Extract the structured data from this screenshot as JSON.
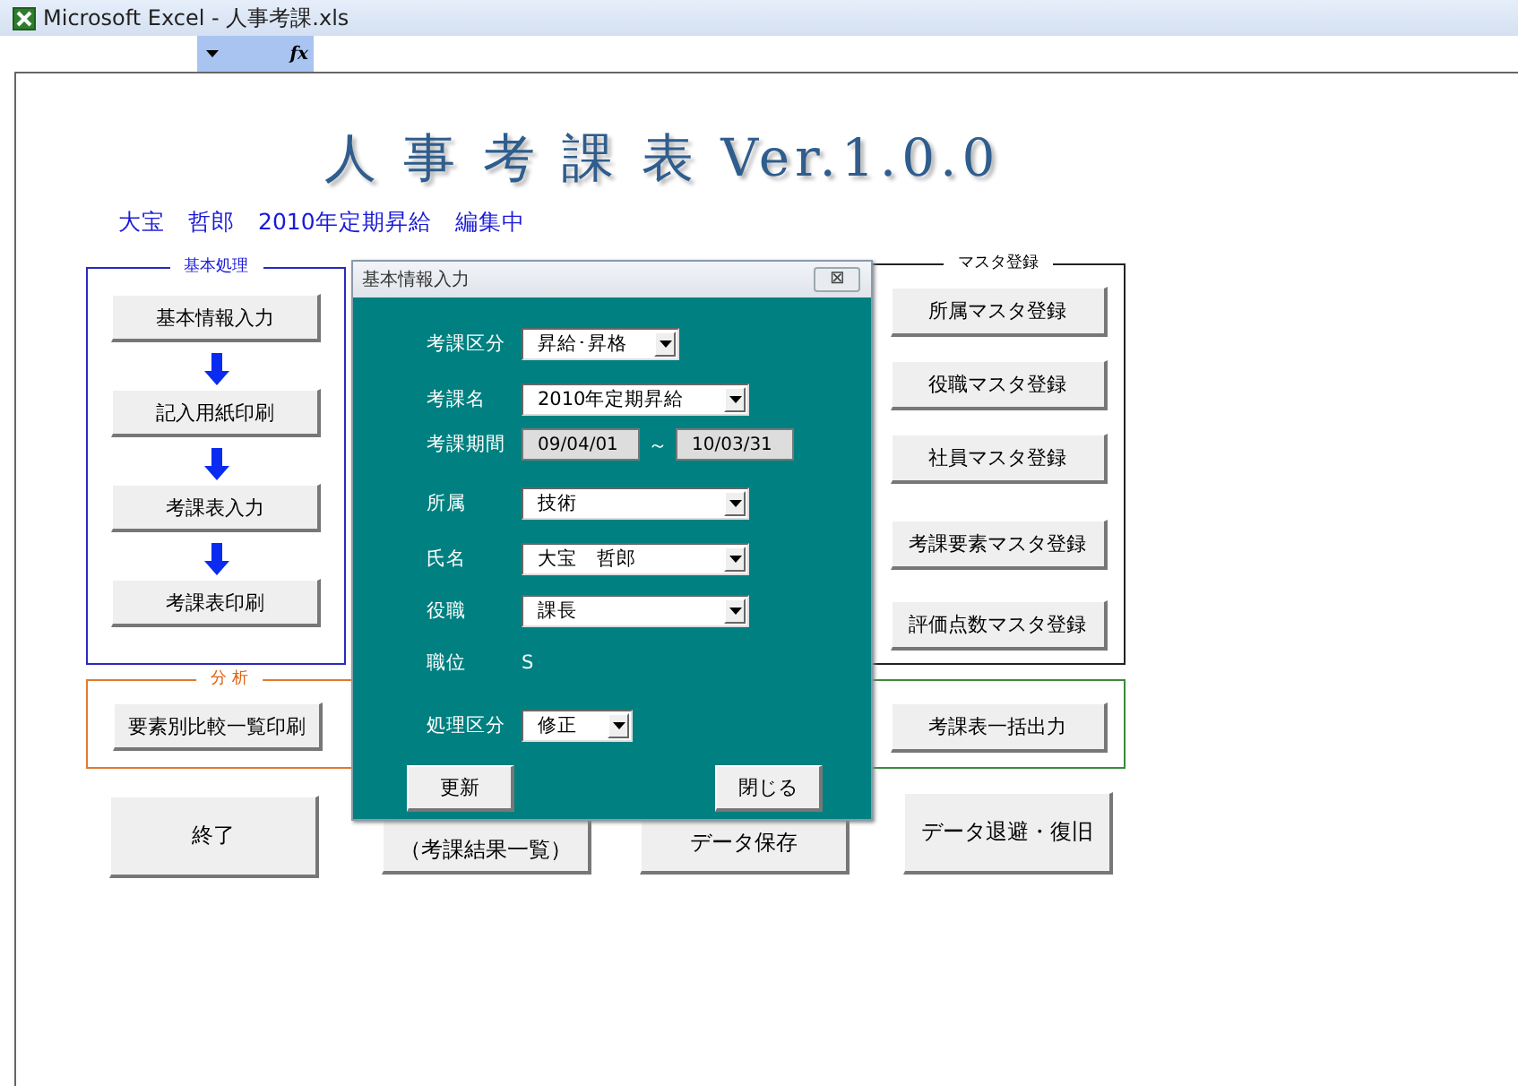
{
  "window": {
    "title": "Microsoft Excel - 人事考課.xls"
  },
  "formula_bar": {
    "fx": "fx"
  },
  "sheet": {
    "title": "人 事 考 課 表 Ver.1.0.0",
    "status": "大宝　哲郎　2010年定期昇給　編集中",
    "basic": {
      "label": "基本処理",
      "buttons": [
        "基本情報入力",
        "記入用紙印刷",
        "考課表入力",
        "考課表印刷"
      ]
    },
    "analysis": {
      "label": "分 析",
      "buttons": [
        "要素別比較一覧印刷"
      ]
    },
    "master": {
      "label": "マスタ登録",
      "buttons": [
        "所属マスタ登録",
        "役職マスタ登録",
        "社員マスタ登録",
        "考課要素マスタ登録",
        "評価点数マスタ登録"
      ]
    },
    "output": {
      "buttons": [
        "考課表一括出力"
      ]
    },
    "bottom_buttons": [
      "終了",
      "（考課結果一覧）",
      "データ保存",
      "データ退避・復旧"
    ]
  },
  "dialog": {
    "title": "基本情報入力",
    "close": "⊠",
    "fields": [
      {
        "kind": "combo",
        "label": "考課区分",
        "value": "昇給･昇格"
      },
      {
        "kind": "combo",
        "label": "考課名",
        "value": "2010年定期昇給"
      },
      {
        "kind": "range",
        "label": "考課期間",
        "from": "09/04/01",
        "sep": "～",
        "to": "10/03/31"
      },
      {
        "kind": "combo",
        "label": "所属",
        "value": "技術"
      },
      {
        "kind": "combo",
        "label": "氏名",
        "value": "大宝　哲郎"
      },
      {
        "kind": "combo",
        "label": "役職",
        "value": "課長"
      },
      {
        "kind": "static",
        "label": "職位",
        "value": "S"
      },
      {
        "kind": "combo",
        "label": "処理区分",
        "value": "修正"
      }
    ],
    "buttons": [
      "更新",
      "閉じる"
    ]
  }
}
